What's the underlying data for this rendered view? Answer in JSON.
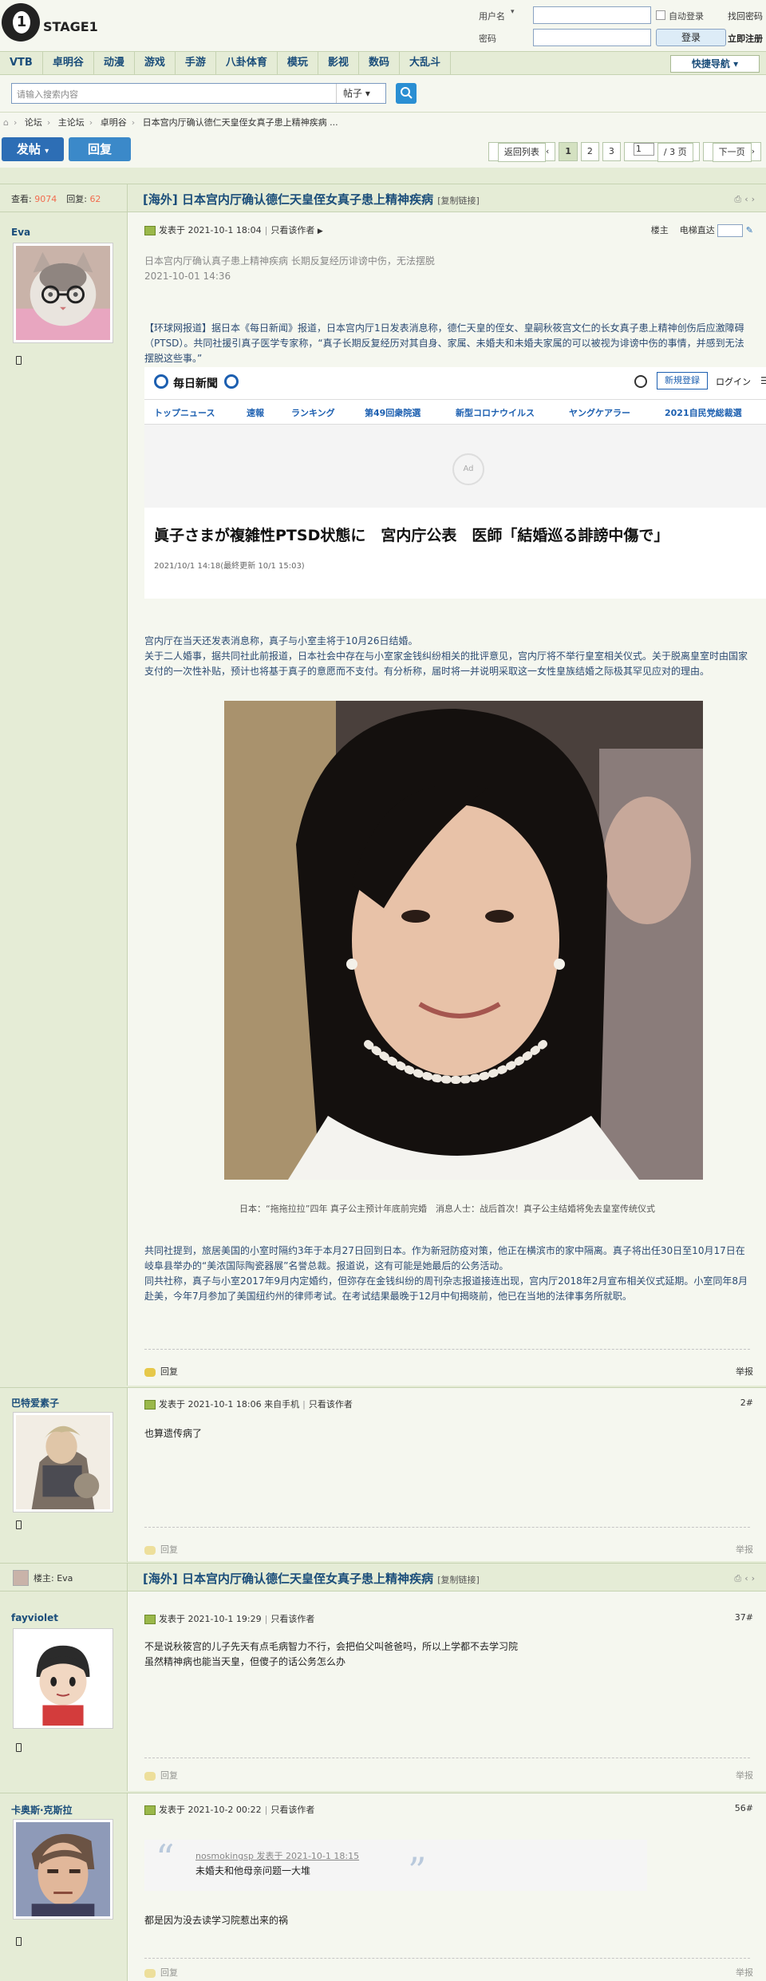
{
  "header": {
    "logo_text": "STAGE1",
    "logo_digit": "1",
    "username_label": "用户名",
    "password_label": "密码",
    "auto_login_label": "自动登录",
    "login_button": "登录",
    "find_password": "找回密码",
    "register": "立即注册"
  },
  "nav": {
    "items": [
      "VTB",
      "卓明谷",
      "动漫",
      "游戏",
      "手游",
      "八卦体育",
      "模玩",
      "影视",
      "数码",
      "大乱斗"
    ],
    "quick": "快捷导航"
  },
  "search": {
    "placeholder": "请输入搜索内容",
    "type": "帖子"
  },
  "breadcrumb": [
    "论坛",
    "主论坛",
    "卓明谷",
    "日本宫内厅确认德仁天皇侄女真子患上精神疾病 ..."
  ],
  "actions": {
    "post": "发帖",
    "reply": "回复",
    "back_list": "返回列表",
    "pages": [
      "1",
      "2",
      "3"
    ],
    "current_page_input": "1",
    "total_pages": "/ 3 页",
    "next": "下一页"
  },
  "thread": {
    "views_label": "查看:",
    "views": "9074",
    "replies_label": "回复:",
    "replies": "62",
    "prefix": "[海外]",
    "title": "日本宫内厅确认德仁天皇侄女真子患上精神疾病",
    "copy_link": "[复制链接]"
  },
  "post1": {
    "author": "Eva",
    "posted": "发表于 2021-10-1 18:04",
    "only_author": "只看该作者",
    "floor": "楼主",
    "jump_label": "电梯直达",
    "summary": "日本宫内厅确认真子患上精神疾病 长期反复经历诽谤中伤，无法摆脱",
    "summary_date": "2021-10-01 14:36",
    "para1": "【环球网报道】据日本《每日新闻》报道，日本宫内厅1日发表消息称，德仁天皇的侄女、皇嗣秋筱宫文仁的长女真子患上精神创伤后应激障碍（PTSD）。共同社援引真子医学专家称，“真子长期反复经历对其自身、家属、未婚夫和未婚夫家属的可以被视为诽谤中伤的事情，并感到无法摆脱这些事。”",
    "mainichi": {
      "logo": "毎日新聞",
      "register": "新規登録",
      "login": "ログイン",
      "nav": [
        "トップニュース",
        "速報",
        "ランキング",
        "第49回衆院選",
        "新型コロナウイルス",
        "ヤングケアラー",
        "2021自民党総裁選"
      ],
      "ad": "Ad",
      "headline": "眞子さまが複雑性PTSD状態に　宮内庁公表　医師「結婚巡る誹謗中傷で」",
      "date": "2021/10/1 14:18(最終更新 10/1 15:03)"
    },
    "para2": "宫内厅在当天还发表消息称，真子与小室圭将于10月26日结婚。",
    "para3": "关于二人婚事，据共同社此前报道，日本社会中存在与小室家金钱纠纷相关的批评意见，宫内厅将不举行皇室相关仪式。关于脱离皇室时由国家支付的一次性补贴，预计也将基于真子的意愿而不支付。有分析称，届时将一并说明采取这一女性皇族结婚之际极其罕见应对的理由。",
    "caption": "日本：“拖拖拉拉”四年 真子公主预计年底前完婚　消息人士：战后首次！真子公主结婚将免去皇室传统仪式",
    "para4": "共同社提到，旅居美国的小室时隔约3年于本月27日回到日本。作为新冠防疫对策，他正在横滨市的家中隔离。真子将出任30日至10月17日在岐阜县举办的“美浓国际陶瓷器展”名誉总裁。报道说，这有可能是她最后的公务活动。",
    "para5": "同共社称，真子与小室2017年9月内定婚约，但弥存在金钱纠纷的周刊杂志报道接连出现，宫内厅2018年2月宣布相关仪式延期。小室同年8月赴美，今年7月参加了美国纽约州的律师考试。在考试结果最晚于12月中旬揭晓前，他已在当地的法律事务所就职。",
    "reply": "回复",
    "report": "举报"
  },
  "post2": {
    "author": "巴特爱素子",
    "posted": "发表于 2021-10-1 18:06 来自手机",
    "only_author": "只看该作者",
    "floor": "2#",
    "text": "也算遗传病了",
    "reply": "回复",
    "report": "举报"
  },
  "thread2": {
    "op_label": "楼主: Eva",
    "prefix": "[海外]",
    "title": "日本宫内厅确认德仁天皇侄女真子患上精神疾病",
    "copy_link": "[复制链接]"
  },
  "post3": {
    "author": "fayviolet",
    "posted": "发表于 2021-10-1 19:29",
    "only_author": "只看该作者",
    "floor": "37#",
    "line1": "不是说秋筱宫的儿子先天有点毛病智力不行，会把伯父叫爸爸吗，所以上学都不去学习院",
    "line2": "虽然精神病也能当天皇，但傻子的话公务怎么办",
    "reply": "回复",
    "report": "举报"
  },
  "post4": {
    "author": "卡奥斯·克斯拉",
    "posted": "发表于 2021-10-2 00:22",
    "only_author": "只看该作者",
    "floor": "56#",
    "quote_src": "nosmokingsp 发表于 2021-10-1 18:15",
    "quote_text": "未婚夫和他母亲问题一大堆",
    "text": "都是因为没去读学习院惹出来的祸",
    "reply": "回复",
    "report": "举报"
  }
}
